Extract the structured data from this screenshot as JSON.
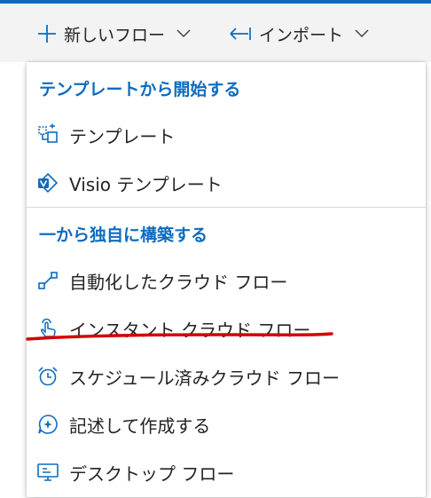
{
  "colors": {
    "accent": "#0f6cbd",
    "annotation": "#d40000"
  },
  "toolbar": {
    "new_flow_label": "新しいフロー",
    "import_label": "インポート",
    "new_flow_icon": "plus-icon",
    "import_icon": "import-arrow-icon"
  },
  "menu": {
    "section_template": "テンプレートから開始する",
    "section_scratch": "一から独自に構築する",
    "items": [
      {
        "label": "テンプレート",
        "icon": "template-icon"
      },
      {
        "label": "Visio テンプレート",
        "icon": "visio-icon"
      },
      {
        "label": "自動化したクラウド フロー",
        "icon": "automated-flow-icon"
      },
      {
        "label": "インスタント クラウド フロー",
        "icon": "touch-hand-icon"
      },
      {
        "label": "スケジュール済みクラウド フロー",
        "icon": "alarm-clock-icon"
      },
      {
        "label": "記述して作成する",
        "icon": "copilot-chat-icon"
      },
      {
        "label": "デスクトップ フロー",
        "icon": "desktop-flow-icon"
      }
    ]
  }
}
